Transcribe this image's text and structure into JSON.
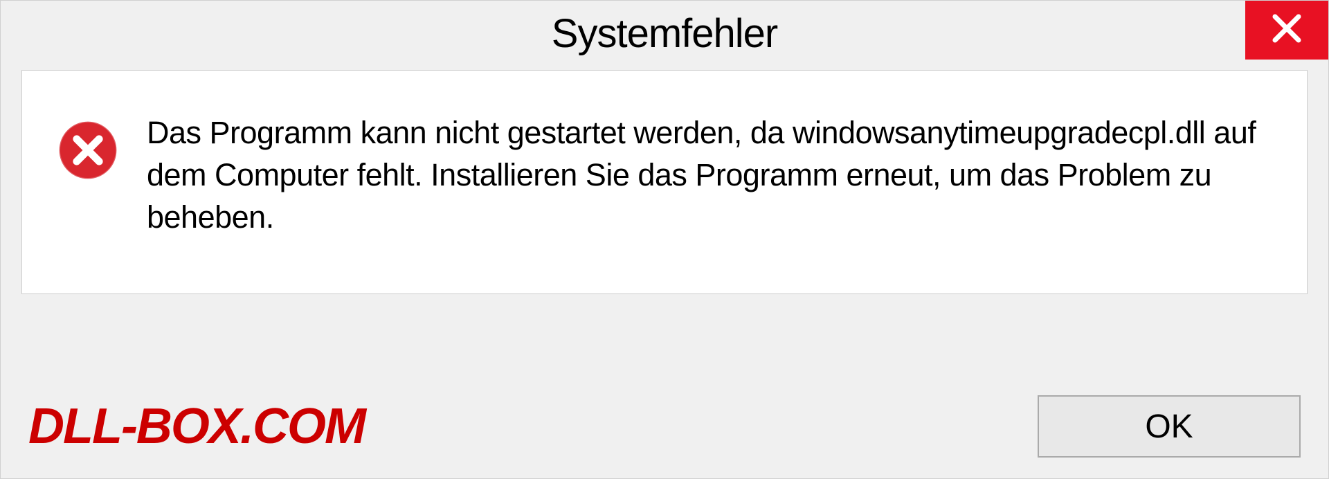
{
  "dialog": {
    "title": "Systemfehler",
    "message": "Das Programm kann nicht gestartet werden, da windowsanytimeupgradecpl.dll auf dem Computer fehlt. Installieren Sie das Programm erneut, um das Problem zu beheben.",
    "ok_label": "OK"
  },
  "watermark": "DLL-BOX.COM"
}
